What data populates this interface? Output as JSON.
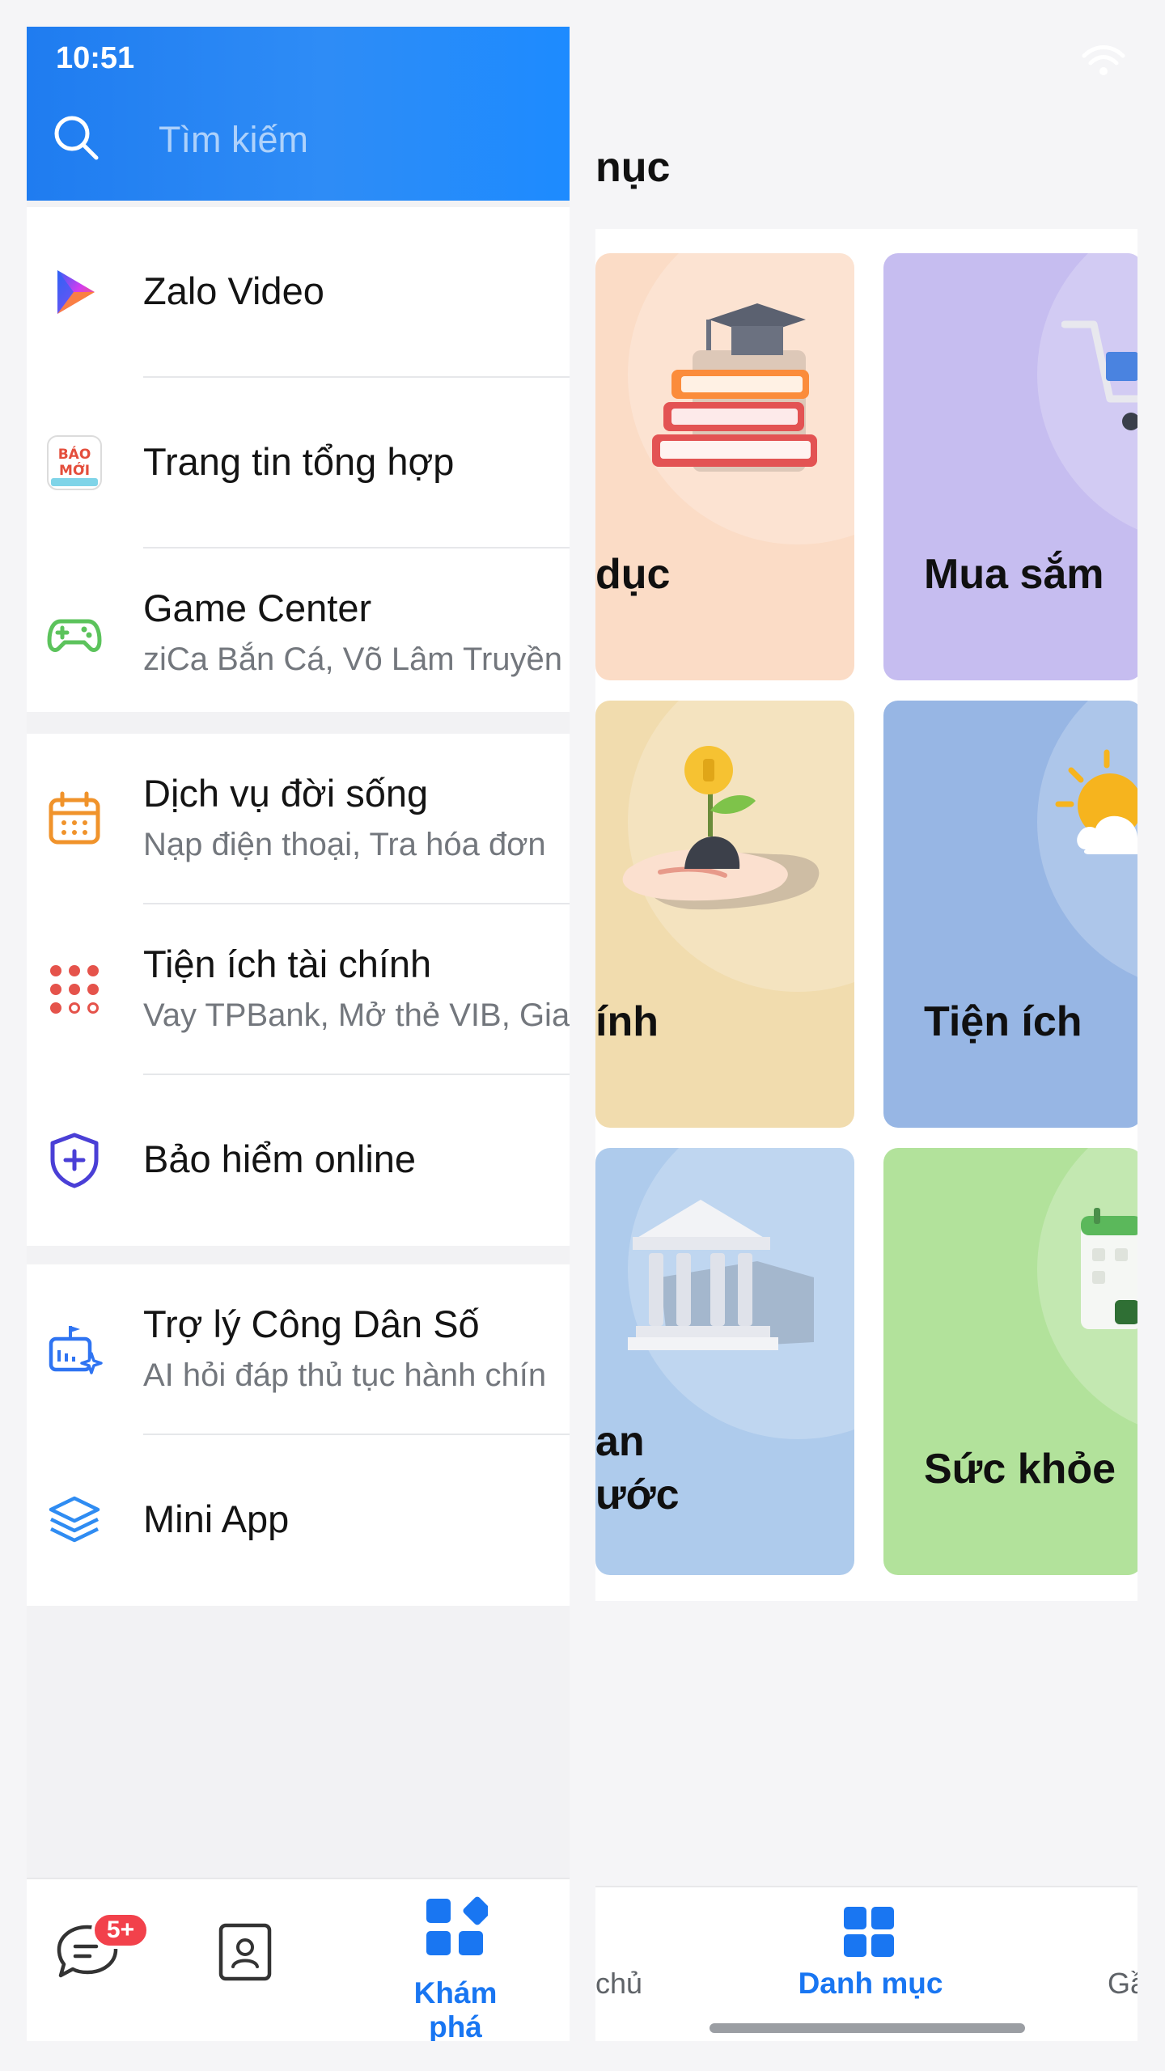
{
  "status_bar": {
    "time": "10:51"
  },
  "search": {
    "placeholder": "Tìm kiếm"
  },
  "menu": {
    "group1": [
      {
        "title": "Zalo Video",
        "subtitle": "",
        "icon": "zalo-video-icon"
      },
      {
        "title": "Trang tin tổng hợp",
        "subtitle": "",
        "icon": "bao-moi-icon",
        "icon_text_1": "BÁO",
        "icon_text_2": "MỚI"
      },
      {
        "title": "Game Center",
        "subtitle": "ziCa Bắn Cá, Võ Lâm Truyền",
        "icon": "gamepad-icon"
      }
    ],
    "group2": [
      {
        "title": "Dịch vụ đời sống",
        "subtitle": "Nạp điện thoại, Tra hóa đơn",
        "icon": "calendar-icon"
      },
      {
        "title": "Tiện ích tài chính",
        "subtitle": "Vay TPBank, Mở thẻ VIB, Gia",
        "icon": "dots-grid-icon"
      },
      {
        "title": "Bảo hiểm online",
        "subtitle": "",
        "icon": "shield-plus-icon"
      }
    ],
    "group3": [
      {
        "title": "Trợ lý Công Dân Số",
        "subtitle": "AI hỏi đáp thủ tục hành chín",
        "icon": "ai-assistant-icon"
      },
      {
        "title": "Mini App",
        "subtitle": "",
        "icon": "layers-icon"
      }
    ]
  },
  "bottom_nav_left": {
    "chat_badge": "5+",
    "explore_label": "Khám phá"
  },
  "right_panel": {
    "title_partial": "nục",
    "cards": [
      {
        "label": "dục",
        "color": "#fbdcc6"
      },
      {
        "label": "Mua sắm",
        "color": "#c6bdf0"
      },
      {
        "label": "ính",
        "color": "#f1dcae"
      },
      {
        "label": "Tiện ích",
        "color": "#97b6e4"
      },
      {
        "label": "an\nước",
        "color": "#aecbec"
      },
      {
        "label": "Sức khỏe",
        "color": "#b2e29b"
      }
    ],
    "bottom_nav": {
      "home_partial": "chủ",
      "category_label": "Danh mục",
      "partial_label": "Gầ"
    }
  },
  "colors": {
    "header_blue": "#1f7cf0",
    "accent_blue": "#1976f2",
    "badge_red": "#f2414b"
  }
}
